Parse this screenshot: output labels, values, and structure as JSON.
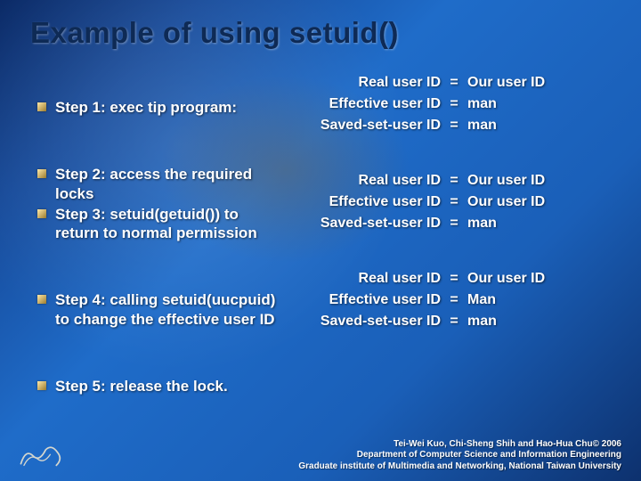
{
  "title": "Example of using setuid()",
  "steps": {
    "s1": "Step 1: exec tip program:",
    "s2": "Step 2: access the required locks",
    "s3": "Step 3: setuid(getuid()) to return to normal permission",
    "s4": "Step 4: calling setuid(uucpuid) to change the effective user ID",
    "s5": "Step 5: release the lock."
  },
  "labels": {
    "real": "Real user ID",
    "eff": "Effective user ID",
    "saved": "Saved-set-user ID",
    "eq": "="
  },
  "tables": {
    "t1": {
      "real": "Our user ID",
      "eff": "man",
      "saved": "man"
    },
    "t2": {
      "real": "Our user ID",
      "eff": "Our user ID",
      "saved": "man"
    },
    "t3": {
      "real": "Our user ID",
      "eff": "Man",
      "saved": "man"
    }
  },
  "footer": {
    "l1": "Tei-Wei Kuo, Chi-Sheng Shih and Hao-Hua Chu© 2006",
    "l2": "Department of Computer Science and Information Engineering",
    "l3": "Graduate institute of Multimedia and Networking, National Taiwan University"
  }
}
